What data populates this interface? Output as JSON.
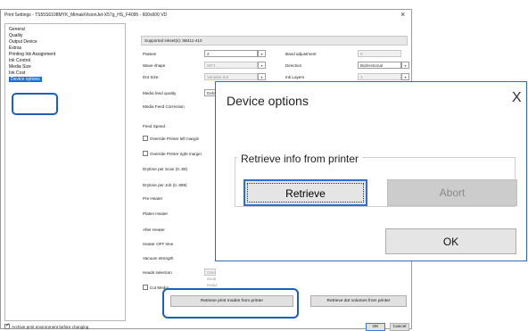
{
  "window": {
    "title": "Print Settings - TS55S6108MYK_MimakiVisionJet-X57g_HS_F4095 - 600x600 VD",
    "close_glyph": "×"
  },
  "sidebar": {
    "items": [
      {
        "label": "General"
      },
      {
        "label": "Quality"
      },
      {
        "label": "Output Device"
      },
      {
        "label": "Extras"
      },
      {
        "label": "Printing Ink Assignment"
      },
      {
        "label": "Ink Control"
      },
      {
        "label": "Media Size"
      },
      {
        "label": "Ink Cost"
      },
      {
        "label": "Device options"
      }
    ],
    "selected": "Device options"
  },
  "panel": {
    "supported_inkset": "Supported inkset(s): 5B411-410",
    "passes_label": "Passes",
    "passes_value": "2",
    "band_adjustment_label": "Band adjustment",
    "band_adjustment_value": "0",
    "wave_shape_label": "Wave shape",
    "wave_shape_value": "WF1",
    "direction_label": "Direction",
    "direction_value": "Bidirectional",
    "dot_size_label": "Dot Size:",
    "dot_size_value": "Variable dot",
    "ink_layers_label": "Ink Layers",
    "ink_layers_value": "1",
    "media_feed_quality_label": "Media feed quality",
    "media_feed_quality_value": "Default",
    "media_feed_correction_label": "Media Feed Correction",
    "feed_speed_label": "Feed Speed",
    "override_left_label": "Override Printer left margin",
    "override_right_label": "Override Printer right margin",
    "drytime_scan_label": "Drytime per Scan (0..99)",
    "drytime_job_label": "Drytime per Job (0..999)",
    "pre_heater_label": "Pre Heater",
    "platen_heater_label": "Platen Heater",
    "after_heater_label": "After Heater",
    "heater_off_label": "Heater OFF time",
    "vacuum_label": "Vacuum strength",
    "heads_selection_label": "Heads selection",
    "heads_selection_value": "One doub Head",
    "cut_media_label": "Cut Media",
    "retrieve_modes_button": "Retrieve print modes from printer",
    "retrieve_dot_button": "Retrieve dot volumes from printer"
  },
  "footer": {
    "archive_label": "Archive print environment before changing",
    "ok_button": "OK",
    "cancel_button": "Cancel"
  },
  "popup": {
    "title": "Device options",
    "close_glyph": "X",
    "group_label": "Retrieve info from printer",
    "retrieve_button": "Retrieve",
    "abort_button": "Abort",
    "ok_button": "OK"
  },
  "colors": {
    "highlight": "#1a5fb8",
    "selection": "#1e6fd1"
  }
}
